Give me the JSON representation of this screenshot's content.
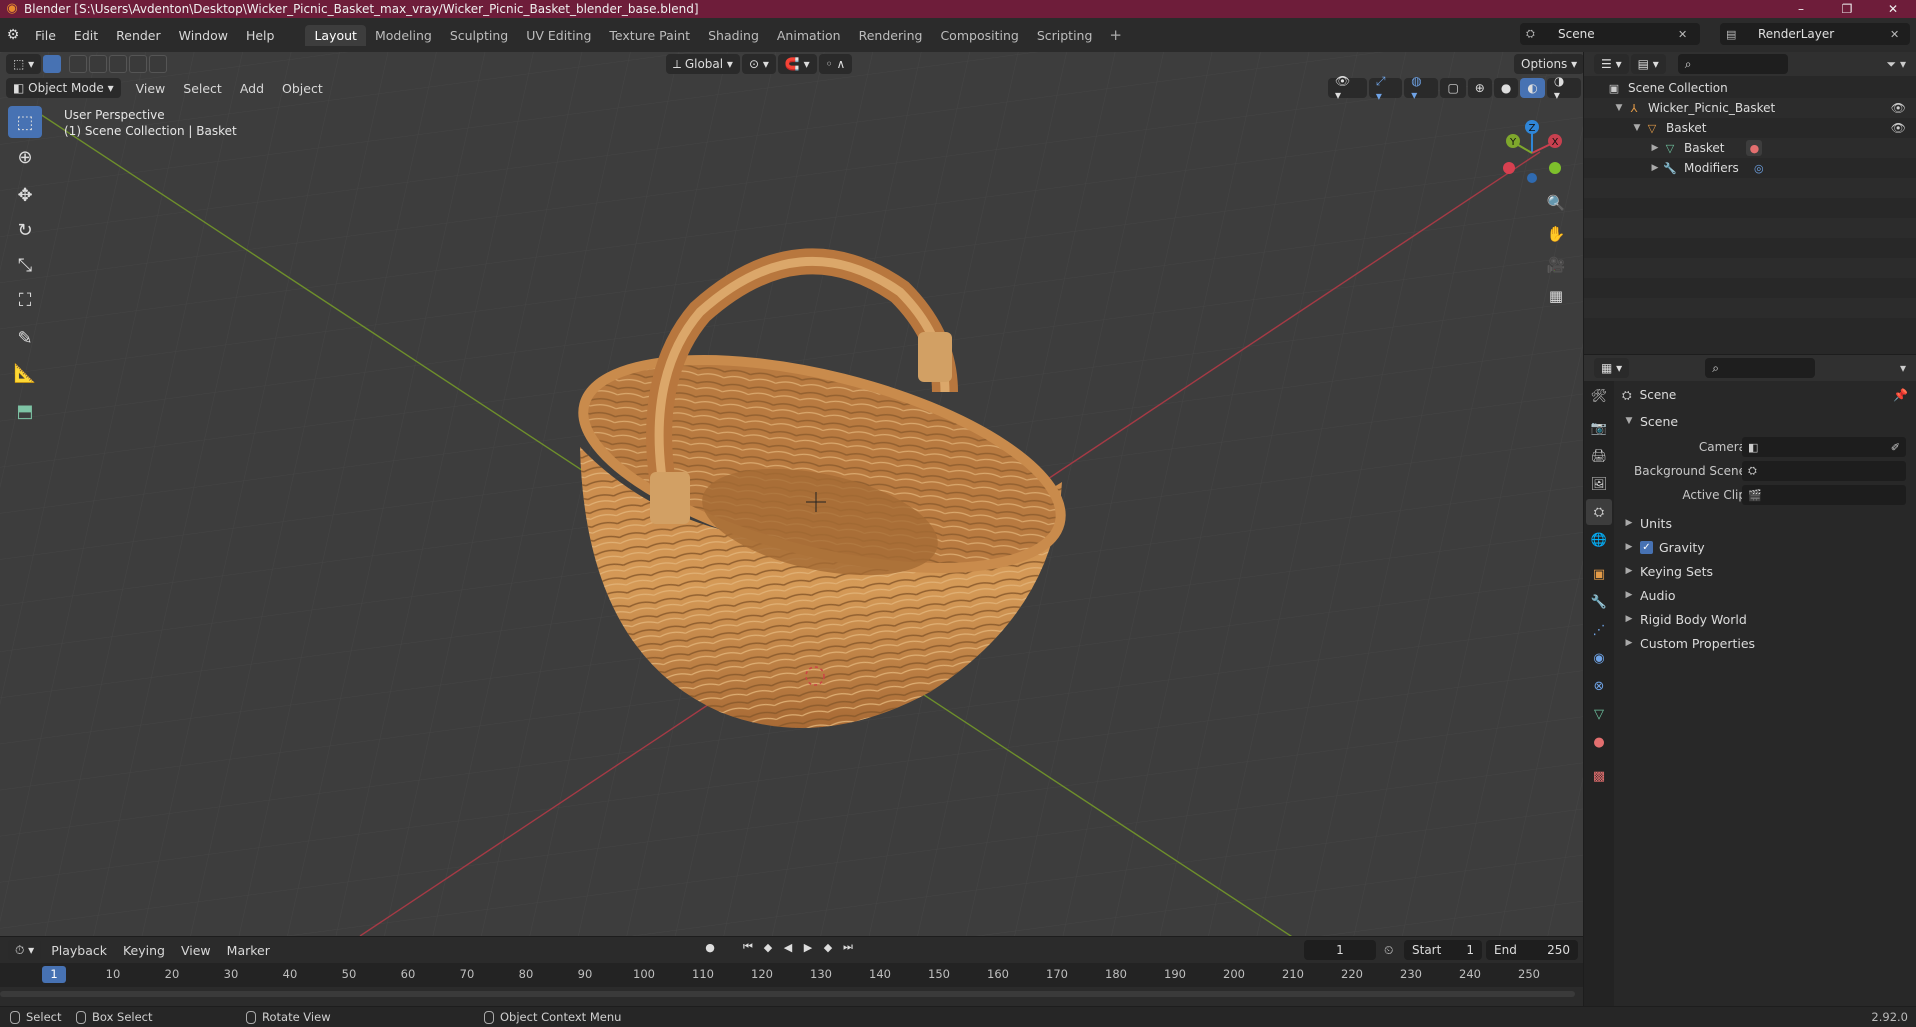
{
  "title_bar": {
    "title": "Blender [S:\\Users\\Avdenton\\Desktop\\Wicker_Picnic_Basket_max_vray/Wicker_Picnic_Basket_blender_base.blend]",
    "minimize": "–",
    "maximize": "❐",
    "close": "✕"
  },
  "menu": [
    "File",
    "Edit",
    "Render",
    "Window",
    "Help"
  ],
  "workspaces": [
    "Layout",
    "Modeling",
    "Sculpting",
    "UV Editing",
    "Texture Paint",
    "Shading",
    "Animation",
    "Rendering",
    "Compositing",
    "Scripting"
  ],
  "active_workspace": "Layout",
  "scene_name": "Scene",
  "view_layer": "RenderLayer",
  "viewport": {
    "mode": "Object Mode",
    "menus": [
      "View",
      "Select",
      "Add",
      "Object"
    ],
    "transform_orientation": "Global",
    "options_label": "Options",
    "perspective_label": "User Perspective",
    "collection_label": "(1) Scene Collection | Basket",
    "gizmo": {
      "x": "X",
      "y": "Y",
      "z": "Z"
    }
  },
  "outliner": {
    "items": [
      {
        "label": "Scene Collection",
        "level": 0
      },
      {
        "label": "Wicker_Picnic_Basket",
        "level": 1
      },
      {
        "label": "Basket",
        "level": 2
      },
      {
        "label": "Basket",
        "level": 3
      },
      {
        "label": "Modifiers",
        "level": 3
      }
    ]
  },
  "properties": {
    "context": "Scene",
    "section": "Scene",
    "fields": [
      {
        "label": "Camera",
        "value": ""
      },
      {
        "label": "Background Scene",
        "value": ""
      },
      {
        "label": "Active Clip",
        "value": ""
      }
    ],
    "panels": [
      "Units",
      "Gravity",
      "Keying Sets",
      "Audio",
      "Rigid Body World",
      "Custom Properties"
    ]
  },
  "timeline": {
    "menus": [
      "Playback",
      "Keying",
      "View",
      "Marker"
    ],
    "current_frame": "1",
    "start_label": "Start",
    "start": "1",
    "end_label": "End",
    "end": "250",
    "ticks": [
      "10",
      "20",
      "30",
      "40",
      "50",
      "60",
      "70",
      "80",
      "90",
      "100",
      "110",
      "120",
      "130",
      "140",
      "150",
      "160",
      "170",
      "180",
      "190",
      "200",
      "210",
      "220",
      "230",
      "240",
      "250"
    ]
  },
  "statusbar": {
    "select": "Select",
    "box_select": "Box Select",
    "rotate": "Rotate View",
    "context_menu": "Object Context Menu",
    "version": "2.92.0"
  },
  "colors": {
    "title_bar": "#6e1d3a",
    "accent": "#4772b3",
    "x_axis": "#c8404f",
    "y_axis": "#7ea72c",
    "z_axis": "#2f86d8"
  }
}
